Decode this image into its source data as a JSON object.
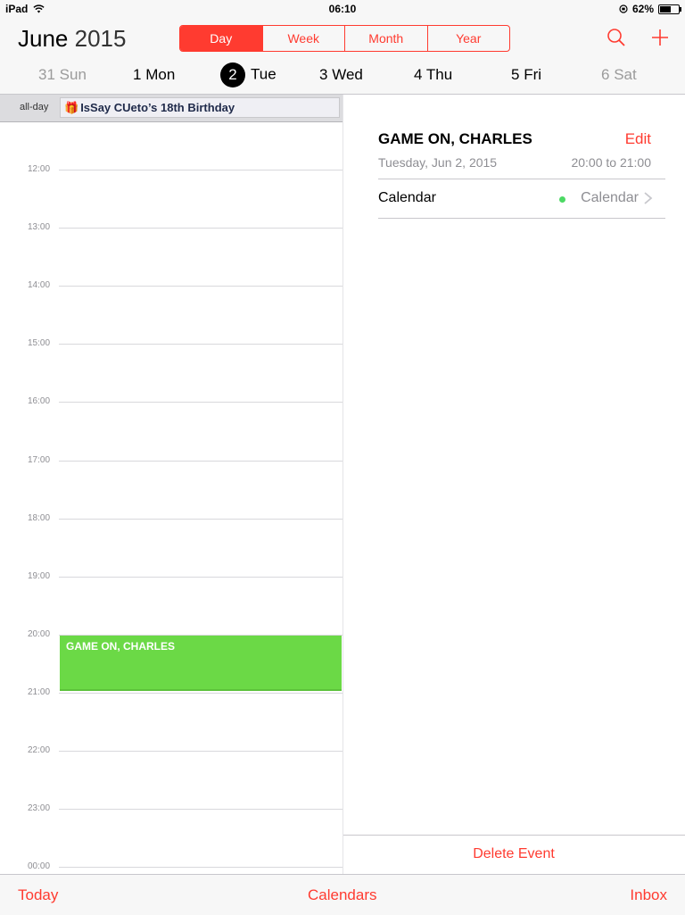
{
  "status": {
    "device": "iPad",
    "time": "06:10",
    "battery": "62%",
    "battery_level": 0.62
  },
  "header": {
    "month": "June",
    "year": "2015",
    "views": [
      "Day",
      "Week",
      "Month",
      "Year"
    ],
    "active_view": "Day",
    "search_icon": "search-icon",
    "add_icon": "plus-icon"
  },
  "days": [
    {
      "num": "31",
      "name": "Sun",
      "muted": true
    },
    {
      "num": "1",
      "name": "Mon",
      "muted": false
    },
    {
      "num": "2",
      "name": "Tue",
      "muted": false,
      "selected": true
    },
    {
      "num": "3",
      "name": "Wed",
      "muted": false
    },
    {
      "num": "4",
      "name": "Thu",
      "muted": false
    },
    {
      "num": "5",
      "name": "Fri",
      "muted": false
    },
    {
      "num": "6",
      "name": "Sat",
      "muted": true
    }
  ],
  "allday": {
    "label": "all-day",
    "event": "IsSay CUeto’s 18th Birthday",
    "icon": "gift-icon"
  },
  "hours": [
    "12:00",
    "13:00",
    "14:00",
    "15:00",
    "16:00",
    "17:00",
    "18:00",
    "19:00",
    "20:00",
    "21:00",
    "22:00",
    "23:00",
    "00:00"
  ],
  "event": {
    "title": "GAME ON, CHARLES",
    "start": "20:00",
    "end": "21:00",
    "color": "#6bd946"
  },
  "detail": {
    "title": "GAME ON, CHARLES",
    "edit_label": "Edit",
    "date": "Tuesday, Jun 2, 2015",
    "time_range": "20:00 to 21:00",
    "calendar_label": "Calendar",
    "calendar_value": "Calendar",
    "calendar_color": "#4cd964",
    "delete_label": "Delete Event"
  },
  "toolbar": {
    "today": "Today",
    "calendars": "Calendars",
    "inbox": "Inbox"
  },
  "colors": {
    "accent": "#ff3b30"
  }
}
